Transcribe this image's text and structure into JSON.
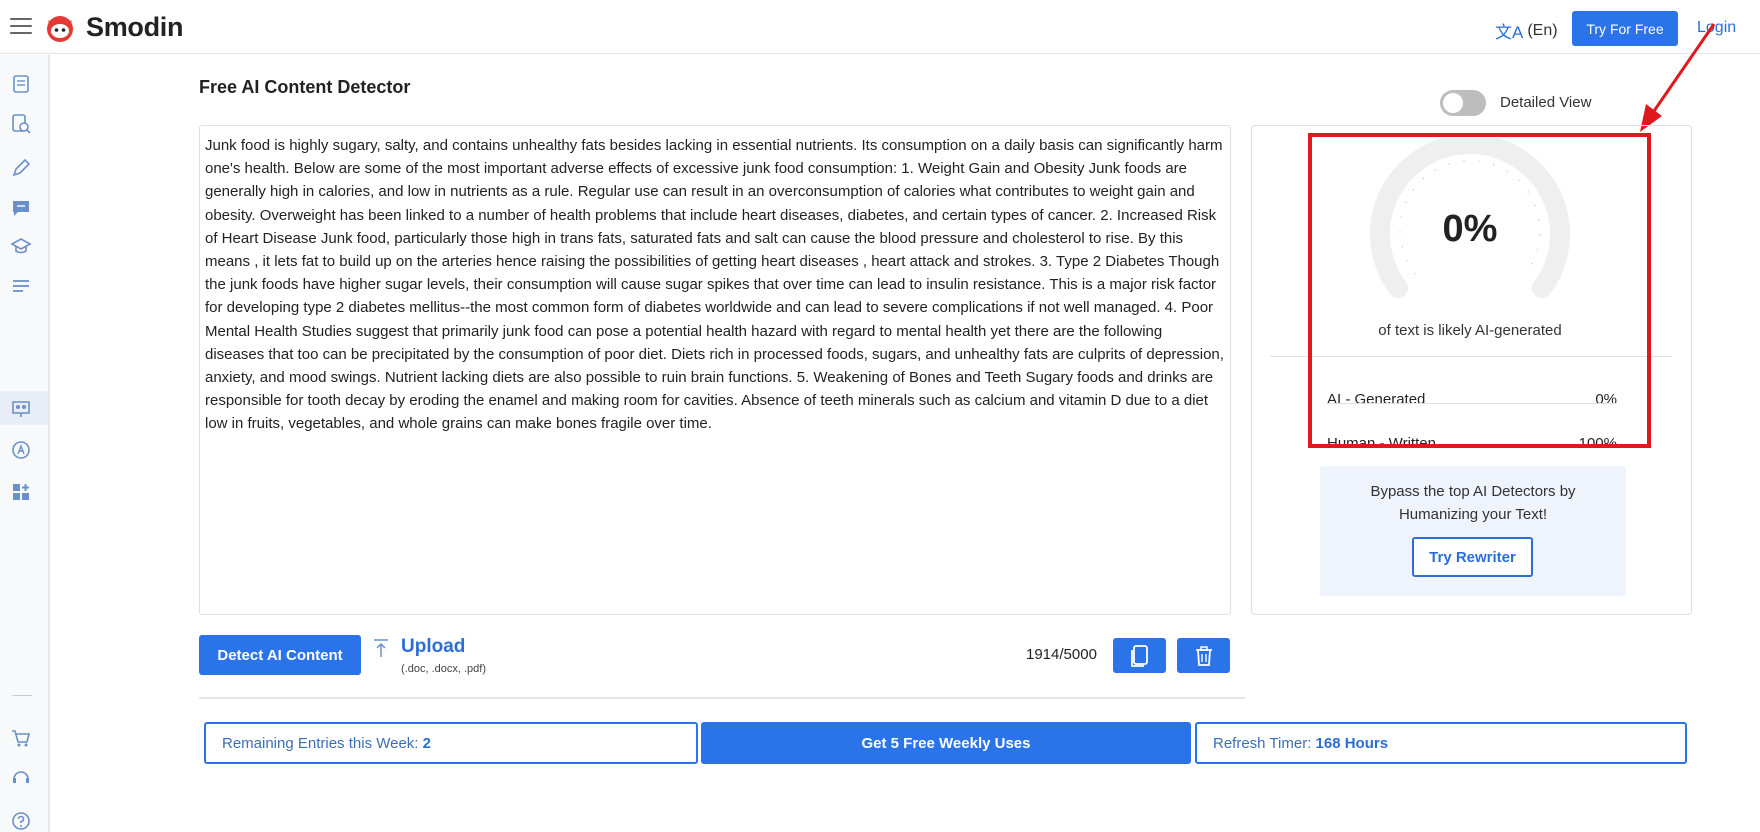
{
  "header": {
    "brand": "Smodin",
    "language": "(En)",
    "try_free_label": "Try For Free",
    "login_label": "Login"
  },
  "sidebar": {
    "icons": [
      "documents-icon",
      "search-document-icon",
      "pencil-icon",
      "chat-icon",
      "graduation-icon",
      "list-icon",
      "ai-detector-icon",
      "translate-icon",
      "apps-icon",
      "cart-icon",
      "support-icon",
      "help-icon"
    ],
    "active": "ai-detector-icon"
  },
  "main": {
    "title": "Free AI Content Detector",
    "detailed_view_label": "Detailed View",
    "detailed_view_on": false,
    "input_text": "Junk food is highly sugary, salty, and contains unhealthy fats besides lacking in essential nutrients. Its consumption on a daily basis can significantly harm one's health. Below are some of the most important adverse effects of excessive junk food consumption: 1. Weight Gain and Obesity Junk foods are generally high in calories, and low in nutrients as a rule. Regular use can result in an overconsumption of calories what contributes to weight gain and obesity. Overweight has been linked to a number of health problems that include heart diseases, diabetes, and certain types of cancer. 2. Increased Risk of Heart Disease Junk food, particularly those high in trans fats, saturated fats and salt can cause the blood pressure and cholesterol to rise. By this means , it lets fat to build up on the arteries hence raising the possibilities of getting heart diseases , heart attack and strokes. 3. Type 2 Diabetes Though the junk foods have higher sugar levels, their consumption will cause sugar spikes that over time can lead to insulin resistance. This is a major risk factor for developing type 2 diabetes mellitus--the most common form of diabetes worldwide and can lead to severe complications if not well managed. 4. Poor Mental Health Studies suggest that primarily junk food can pose a potential health hazard with regard to mental health yet there are the following diseases that too can be precipitated by the consumption of poor diet. Diets rich in processed foods, sugars, and unhealthy fats are culprits of depression, anxiety, and mood swings. Nutrient lacking diets are also possible to ruin brain functions. 5. Weakening of Bones and Teeth Sugary foods and drinks are responsible for tooth decay by eroding the enamel and making room for cavities. Absence of teeth minerals such as calcium and vitamin D due to a diet low in fruits, vegetables, and whole grains can make bones fragile over time.",
    "detect_label": "Detect AI Content",
    "upload_label": "Upload",
    "upload_hint": "(.doc, .docx, .pdf)",
    "char_count": "1914/5000"
  },
  "result": {
    "percent": "0%",
    "likely_text": "of text is likely AI-generated",
    "ai_label": "AI - Generated",
    "ai_value": "0%",
    "human_label": "Human - Written",
    "human_value": "100%",
    "bypass_text": "Bypass the top AI Detectors by Humanizing your Text!",
    "rewriter_label": "Try Rewriter"
  },
  "footer": {
    "remaining_label": "Remaining Entries this Week:",
    "remaining_value": "2",
    "weekly_label": "Get 5 Free Weekly Uses",
    "refresh_label": "Refresh Timer:",
    "refresh_value": "168 Hours"
  },
  "colors": {
    "accent": "#2b73e8",
    "highlight": "#e0191f"
  }
}
